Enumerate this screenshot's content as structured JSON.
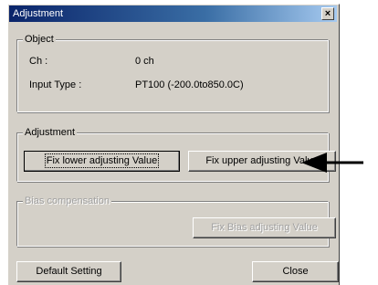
{
  "window": {
    "title": "Adjustment",
    "close_glyph": "×"
  },
  "object_group": {
    "legend": "Object",
    "ch_label": "Ch :",
    "ch_value": "0 ch",
    "input_type_label": "Input Type :",
    "input_type_value": "PT100 (-200.0to850.0C)"
  },
  "adjustment_group": {
    "legend": "Adjustment",
    "fix_lower_label": "Fix lower adjusting Value",
    "fix_upper_label": "Fix upper adjusting Value"
  },
  "bias_group": {
    "legend": "Bias compensation",
    "fix_bias_label": "Fix Bias adjusting Value"
  },
  "footer": {
    "default_setting_label": "Default Setting",
    "close_label": "Close"
  },
  "annotation": {
    "arrow_icon": "left-arrow-icon",
    "arrow_color": "#000000"
  }
}
